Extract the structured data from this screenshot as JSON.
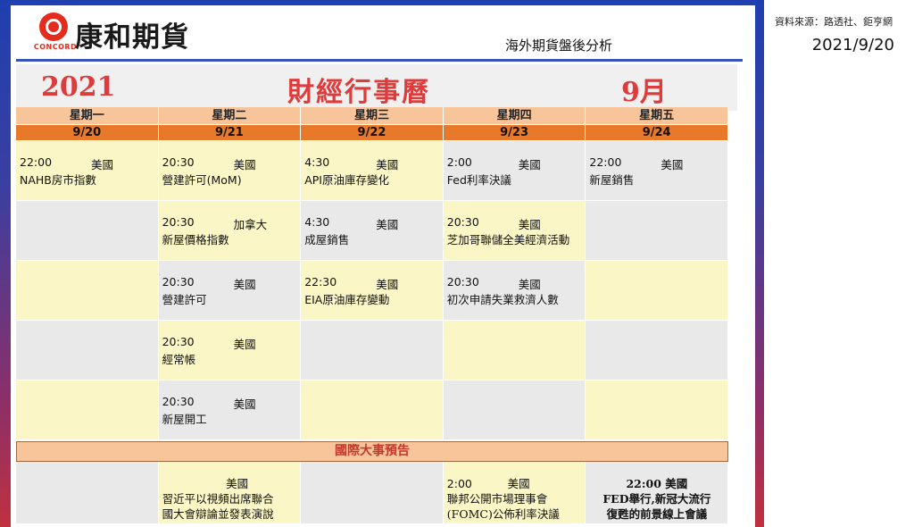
{
  "brand": {
    "name": "康和期貨",
    "logo_text": "CONCORD"
  },
  "source": "資料來源：路透社、鉅亨網",
  "subtitle": "海外期貨盤後分析",
  "date": "2021/9/20",
  "title": {
    "year": "2021",
    "main": "財經行事曆",
    "month": "9月"
  },
  "days": [
    {
      "weekday": "星期一",
      "date": "9/20"
    },
    {
      "weekday": "星期二",
      "date": "9/21"
    },
    {
      "weekday": "星期三",
      "date": "9/22"
    },
    {
      "weekday": "星期四",
      "date": "9/23"
    },
    {
      "weekday": "星期五",
      "date": "9/24"
    }
  ],
  "events": [
    [
      {
        "time": "22:00",
        "country": "美國",
        "name": "NAHB房市指數"
      },
      {
        "time": "20:30",
        "country": "美國",
        "name": "營建許可(MoM)"
      },
      {
        "time": "4:30",
        "country": "美國",
        "name": "API原油庫存變化"
      },
      {
        "time": "2:00",
        "country": "美國",
        "name": "Fed利率決議"
      },
      {
        "time": "22:00",
        "country": "美國",
        "name": "新屋銷售"
      }
    ],
    [
      {
        "time": "",
        "country": "",
        "name": ""
      },
      {
        "time": "20:30",
        "country": "加拿大",
        "name": "新屋價格指數"
      },
      {
        "time": "4:30",
        "country": "美國",
        "name": "成屋銷售"
      },
      {
        "time": "20:30",
        "country": "美國",
        "name": "芝加哥聯儲全美經濟活動"
      },
      {
        "time": "",
        "country": "",
        "name": ""
      }
    ],
    [
      {
        "time": "",
        "country": "",
        "name": ""
      },
      {
        "time": "20:30",
        "country": "美國",
        "name": "營建許可"
      },
      {
        "time": "22:30",
        "country": "美國",
        "name": "EIA原油庫存變動"
      },
      {
        "time": "20:30",
        "country": "美國",
        "name": "初次申請失業救濟人數"
      },
      {
        "time": "",
        "country": "",
        "name": ""
      }
    ],
    [
      {
        "time": "",
        "country": "",
        "name": ""
      },
      {
        "time": "20:30",
        "country": "美國",
        "name": "經常帳"
      },
      {
        "time": "",
        "country": "",
        "name": ""
      },
      {
        "time": "",
        "country": "",
        "name": ""
      },
      {
        "time": "",
        "country": "",
        "name": ""
      }
    ],
    [
      {
        "time": "",
        "country": "",
        "name": ""
      },
      {
        "time": "20:30",
        "country": "美國",
        "name": "新屋開工"
      },
      {
        "time": "",
        "country": "",
        "name": ""
      },
      {
        "time": "",
        "country": "",
        "name": ""
      },
      {
        "time": "",
        "country": "",
        "name": ""
      }
    ]
  ],
  "intl_title": "國際大事預告",
  "intl": [
    {
      "lines": [
        "",
        "",
        ""
      ]
    },
    {
      "lines": [
        "                  美國",
        "習近平以視頻出席聯合",
        "國大會辯論並發表演說"
      ]
    },
    {
      "lines": [
        "",
        "",
        ""
      ]
    },
    {
      "lines": [
        "2:00          美國",
        "聯邦公開市場理事會",
        "(FOMC)公佈利率決議"
      ]
    },
    {
      "lines": [
        "22:00 美國",
        "FED舉行,新冠大流行",
        "復甦的前景線上會議"
      ]
    }
  ],
  "colors": {
    "accent_red": "#e03b3b",
    "day_header": "#f8c49a",
    "date_header": "#e8782a",
    "yellow_cell": "#fbf6c6",
    "gray_cell": "#e9e9e9"
  }
}
